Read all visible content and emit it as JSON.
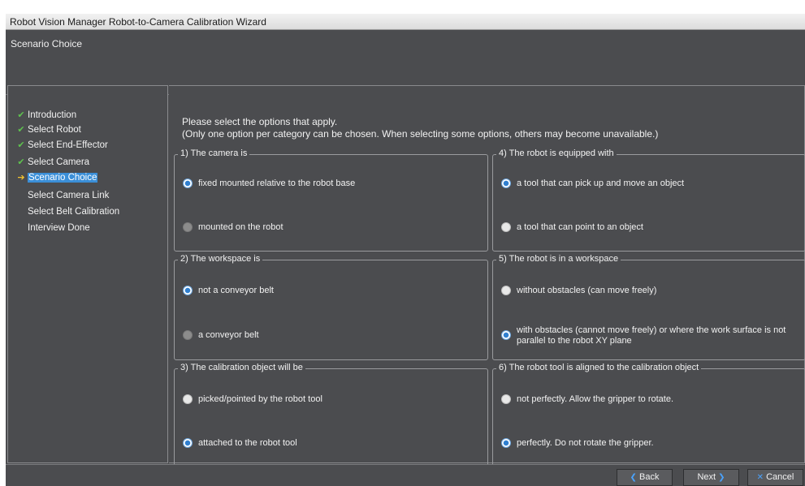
{
  "window": {
    "title": "Robot Vision Manager Robot-to-Camera Calibration Wizard"
  },
  "header": {
    "step_title": "Scenario Choice"
  },
  "nav": {
    "items": [
      {
        "label": "Introduction",
        "marker": "✔"
      },
      {
        "label": "Select Robot",
        "marker": "✔"
      },
      {
        "label": "Select End-Effector",
        "marker": "✔"
      },
      {
        "label": "Select Camera",
        "marker": "✔"
      },
      {
        "label": "Scenario Choice",
        "marker": "➔"
      },
      {
        "label": "Select Camera Link",
        "marker": ""
      },
      {
        "label": "Select Belt Calibration",
        "marker": ""
      },
      {
        "label": "Interview Done",
        "marker": ""
      }
    ]
  },
  "instructions": {
    "line1": "Please select the options that apply.",
    "line2": "(Only one option per category can be chosen. When selecting some options, others may become unavailable.)"
  },
  "groups": [
    {
      "legend": "1) The camera is",
      "options": [
        {
          "label": "fixed mounted relative to the robot base",
          "state": "selected"
        },
        {
          "label": "mounted on the robot",
          "state": "disabled"
        }
      ]
    },
    {
      "legend": "2) The workspace is",
      "options": [
        {
          "label": "not a conveyor belt",
          "state": "selected"
        },
        {
          "label": "a conveyor belt",
          "state": "disabled"
        }
      ]
    },
    {
      "legend": "3) The calibration object will be",
      "options": [
        {
          "label": "picked/pointed by the robot tool",
          "state": "unselected"
        },
        {
          "label": "attached to the robot tool",
          "state": "selected"
        }
      ]
    },
    {
      "legend": "4) The robot is equipped with",
      "options": [
        {
          "label": "a tool that can pick up and move an object",
          "state": "selected"
        },
        {
          "label": "a tool that can point to an object",
          "state": "unselected"
        }
      ]
    },
    {
      "legend": "5) The robot is in a workspace",
      "options": [
        {
          "label": "without obstacles (can move freely)",
          "state": "unselected"
        },
        {
          "label": "with obstacles (cannot move freely) or where the work surface is not parallel to the robot XY plane",
          "state": "selected"
        }
      ]
    },
    {
      "legend": "6) The robot tool is aligned to the calibration object",
      "options": [
        {
          "label": "not perfectly. Allow the gripper to rotate.",
          "state": "unselected"
        },
        {
          "label": "perfectly. Do not rotate the gripper.",
          "state": "selected"
        }
      ]
    }
  ],
  "footer": {
    "back_label": "Back",
    "next_label": "Next",
    "cancel_label": "Cancel"
  },
  "colors": {
    "background": "#4b4c4f",
    "accent": "#3b8fd8",
    "check": "#5fc24f"
  }
}
